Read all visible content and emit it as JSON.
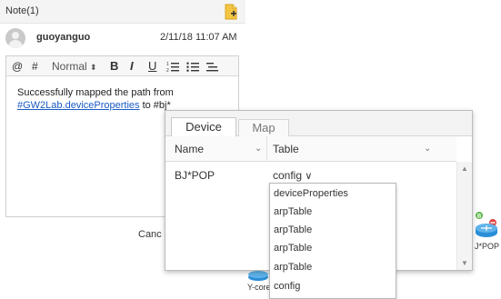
{
  "note": {
    "title": "Note(1)",
    "author": "guoyanguo",
    "timestamp": "2/11/18 11:07 AM",
    "toolbar": {
      "mention": "@",
      "hash": "#",
      "format": "Normal",
      "bold": "B",
      "italic": "I",
      "underline": "U"
    },
    "body_text": "Successfully mapped the path from",
    "body_link": "#GW2Lab.deviceProperties",
    "body_suffix": " to #bj*",
    "cancel_label": "Canc"
  },
  "popup": {
    "tabs": [
      "Device",
      "Map"
    ],
    "columns": [
      "Name",
      "Table"
    ],
    "row": {
      "name": "BJ*POP",
      "table": "config"
    },
    "dropdown_options": [
      "deviceProperties",
      "arpTable",
      "arpTable",
      "arpTable",
      "arpTable",
      "config"
    ]
  },
  "topology": {
    "node_right": "J*POP",
    "node_left": "Y-core"
  },
  "colors": {
    "link": "#1a5bc4",
    "router": "#2a8fd6",
    "status_green": "#5bb84a",
    "status_red": "#e04545"
  }
}
